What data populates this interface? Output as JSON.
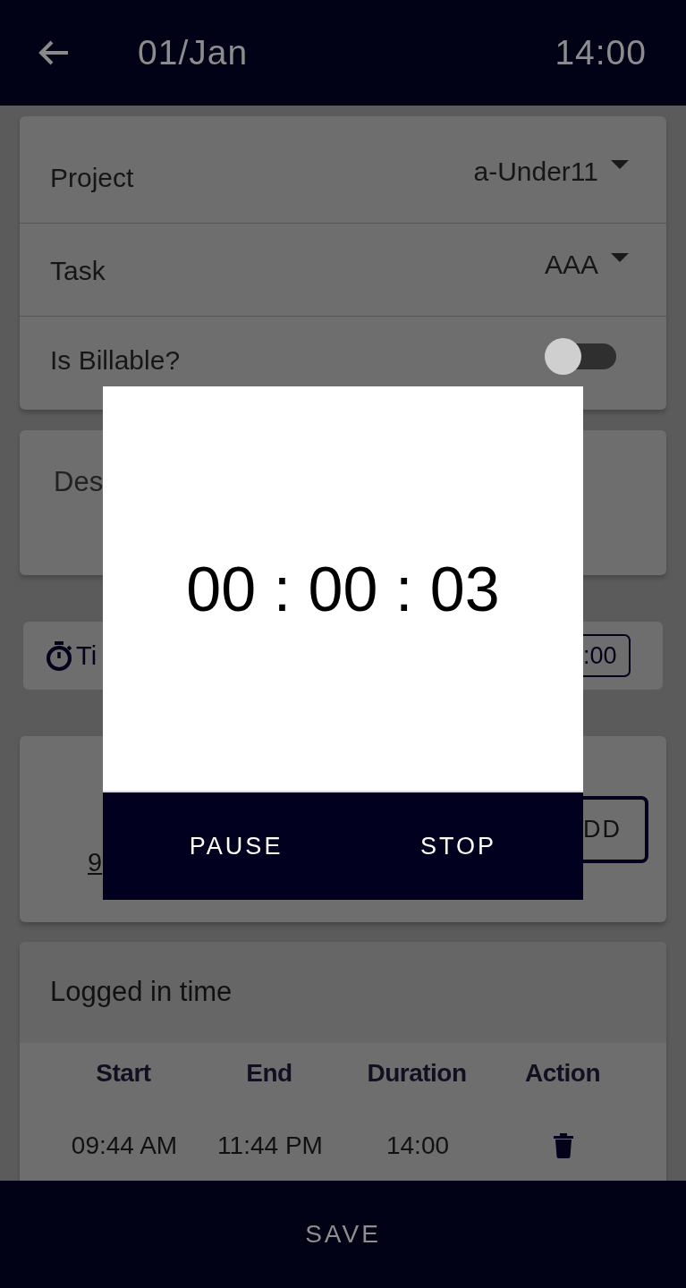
{
  "header": {
    "date": "01/Jan",
    "time": "14:00"
  },
  "fields": [
    {
      "label": "Project",
      "value": "a-Under11",
      "kind": "dropdown"
    },
    {
      "label": "Task",
      "value": "AAA",
      "kind": "dropdown"
    },
    {
      "label": "Is Billable?",
      "kind": "toggle",
      "on": false
    }
  ],
  "description": {
    "placeholder": "Des"
  },
  "timer_bar": {
    "label": "Ti",
    "value": ":00"
  },
  "entry_card": {
    "date_link": "9",
    "add_button": "DD"
  },
  "logged": {
    "title": "Logged in time",
    "columns": [
      "Start",
      "End",
      "Duration",
      "Action"
    ],
    "rows": [
      {
        "start": "09:44 AM",
        "end": "11:44 PM",
        "duration": "14:00"
      }
    ]
  },
  "dialog": {
    "elapsed": "00 : 00 : 03",
    "buttons": [
      "PAUSE",
      "STOP"
    ]
  },
  "save_button": "SAVE"
}
